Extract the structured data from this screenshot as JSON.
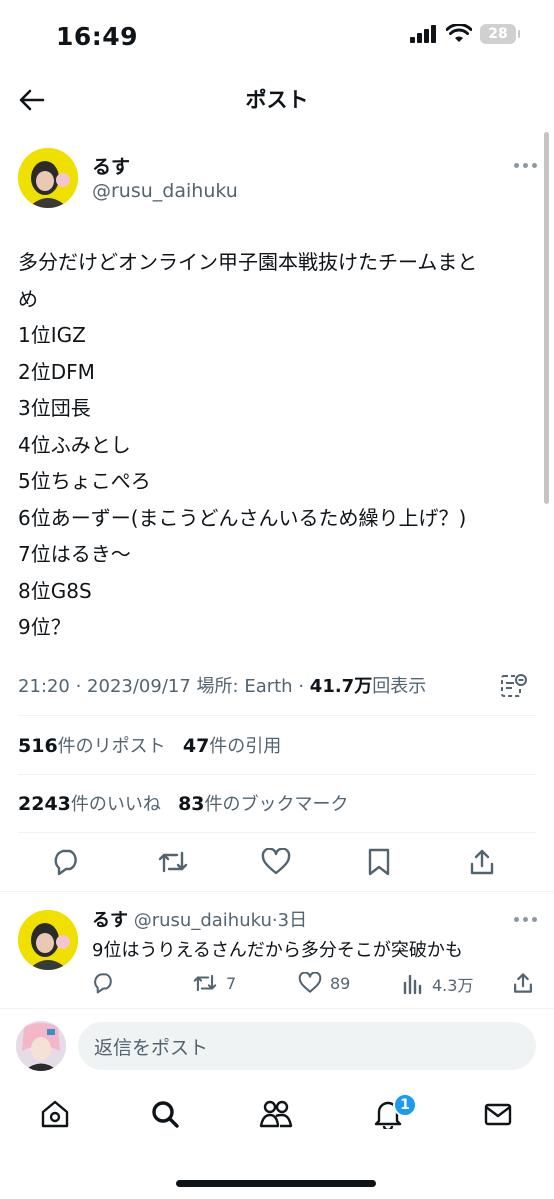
{
  "status_bar": {
    "time": "16:49",
    "battery": "28"
  },
  "header": {
    "title": "ポスト"
  },
  "post": {
    "author_name": "るす",
    "author_handle": "@rusu_daihuku",
    "lines": [
      "多分だけどオンライン甲子園本戦抜けたチームまと",
      "め",
      "1位IGZ",
      "2位DFM",
      "3位団長",
      "4位ふみとし",
      "5位ちょこぺろ",
      "6位あーずー(まこうどんさんいるため繰り上げ？)",
      "7位はるき〜",
      "8位G8S",
      "9位？"
    ],
    "timestamp": "21:20 · 2023/09/17",
    "location_label": "場所: Earth",
    "views_count": "41.7万",
    "views_label": "回表示",
    "repost_count": "516",
    "repost_label": "件のリポスト",
    "quote_count": "47",
    "quote_label": "件の引用",
    "like_count": "2243",
    "like_label": "件のいいね",
    "bookmark_count": "83",
    "bookmark_label": "件のブックマーク"
  },
  "reply": {
    "author_name": "るす",
    "author_handle": "@rusu_daihuku",
    "time": "3日",
    "text": "9位はうりえるさんだから多分そこが突破かも",
    "repost_count": "7",
    "like_count": "89",
    "views_count": "4.3万"
  },
  "compose": {
    "placeholder": "返信をポスト"
  },
  "tabbar": {
    "notification_badge": "1"
  },
  "colors": {
    "accent": "#1d9bf0",
    "text": "#0f1419",
    "secondary": "#536471",
    "avatar_bg": "#f0e000"
  },
  "icons": [
    "back-arrow-icon",
    "more-icon",
    "reply-icon",
    "repost-icon",
    "like-icon",
    "bookmark-icon",
    "share-icon",
    "views-icon",
    "home-icon",
    "search-icon",
    "communities-icon",
    "notifications-icon",
    "messages-icon",
    "grok-analytics-icon"
  ]
}
